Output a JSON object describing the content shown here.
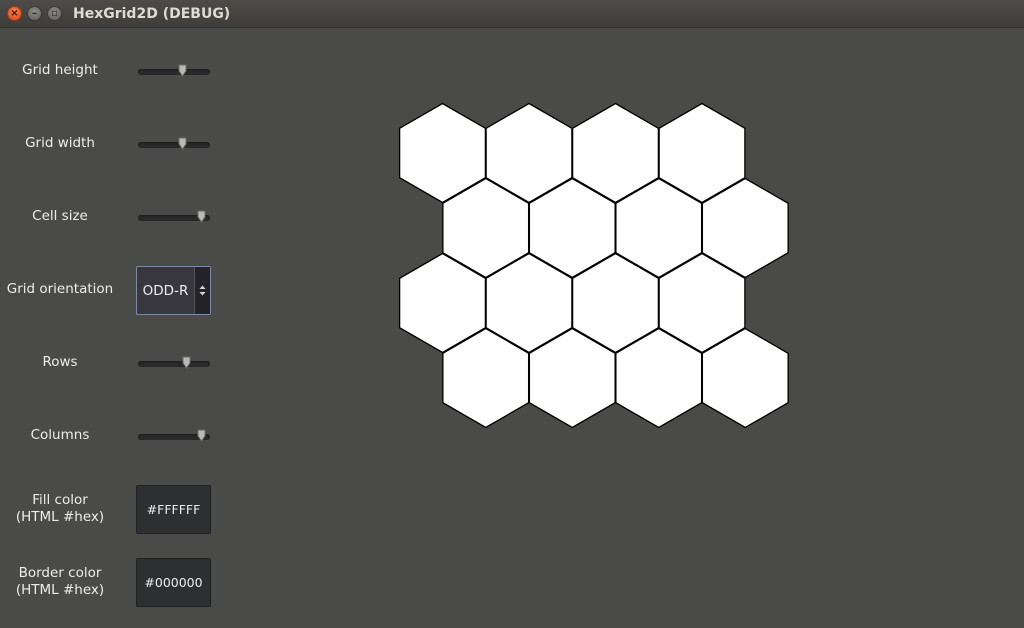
{
  "window": {
    "title": "HexGrid2D (DEBUG)",
    "close_glyph": "×",
    "minimize_glyph": "–",
    "maximize_glyph": "▫"
  },
  "controls": {
    "grid_height": {
      "label": "Grid height",
      "value": 0.62
    },
    "grid_width": {
      "label": "Grid width",
      "value": 0.62
    },
    "cell_size": {
      "label": "Cell size",
      "value": 0.92
    },
    "grid_orientation": {
      "label": "Grid orientation",
      "value": "ODD-R"
    },
    "rows": {
      "label": "Rows",
      "value": 0.68
    },
    "columns": {
      "label": "Columns",
      "value": 0.92
    },
    "fill_color": {
      "label_line1": "Fill color",
      "label_line2": "(HTML #hex)",
      "value": "#FFFFFF"
    },
    "border_color": {
      "label_line1": "Border color",
      "label_line2": "(HTML #hex)",
      "value": "#000000"
    }
  },
  "grid": {
    "rows": 4,
    "columns": 4,
    "orientation": "ODD-R",
    "fill": "#FFFFFF",
    "border": "#000000"
  },
  "colors": {
    "background": "#4a4b48",
    "close_button": "#e2592a",
    "combo_border": "#7f8aa8"
  },
  "icons": {
    "close": "close-icon",
    "minimize": "minimize-icon",
    "maximize": "maximize-icon",
    "combo_arrows": "up-down-arrows-icon",
    "slider_handle": "slider-handle"
  }
}
